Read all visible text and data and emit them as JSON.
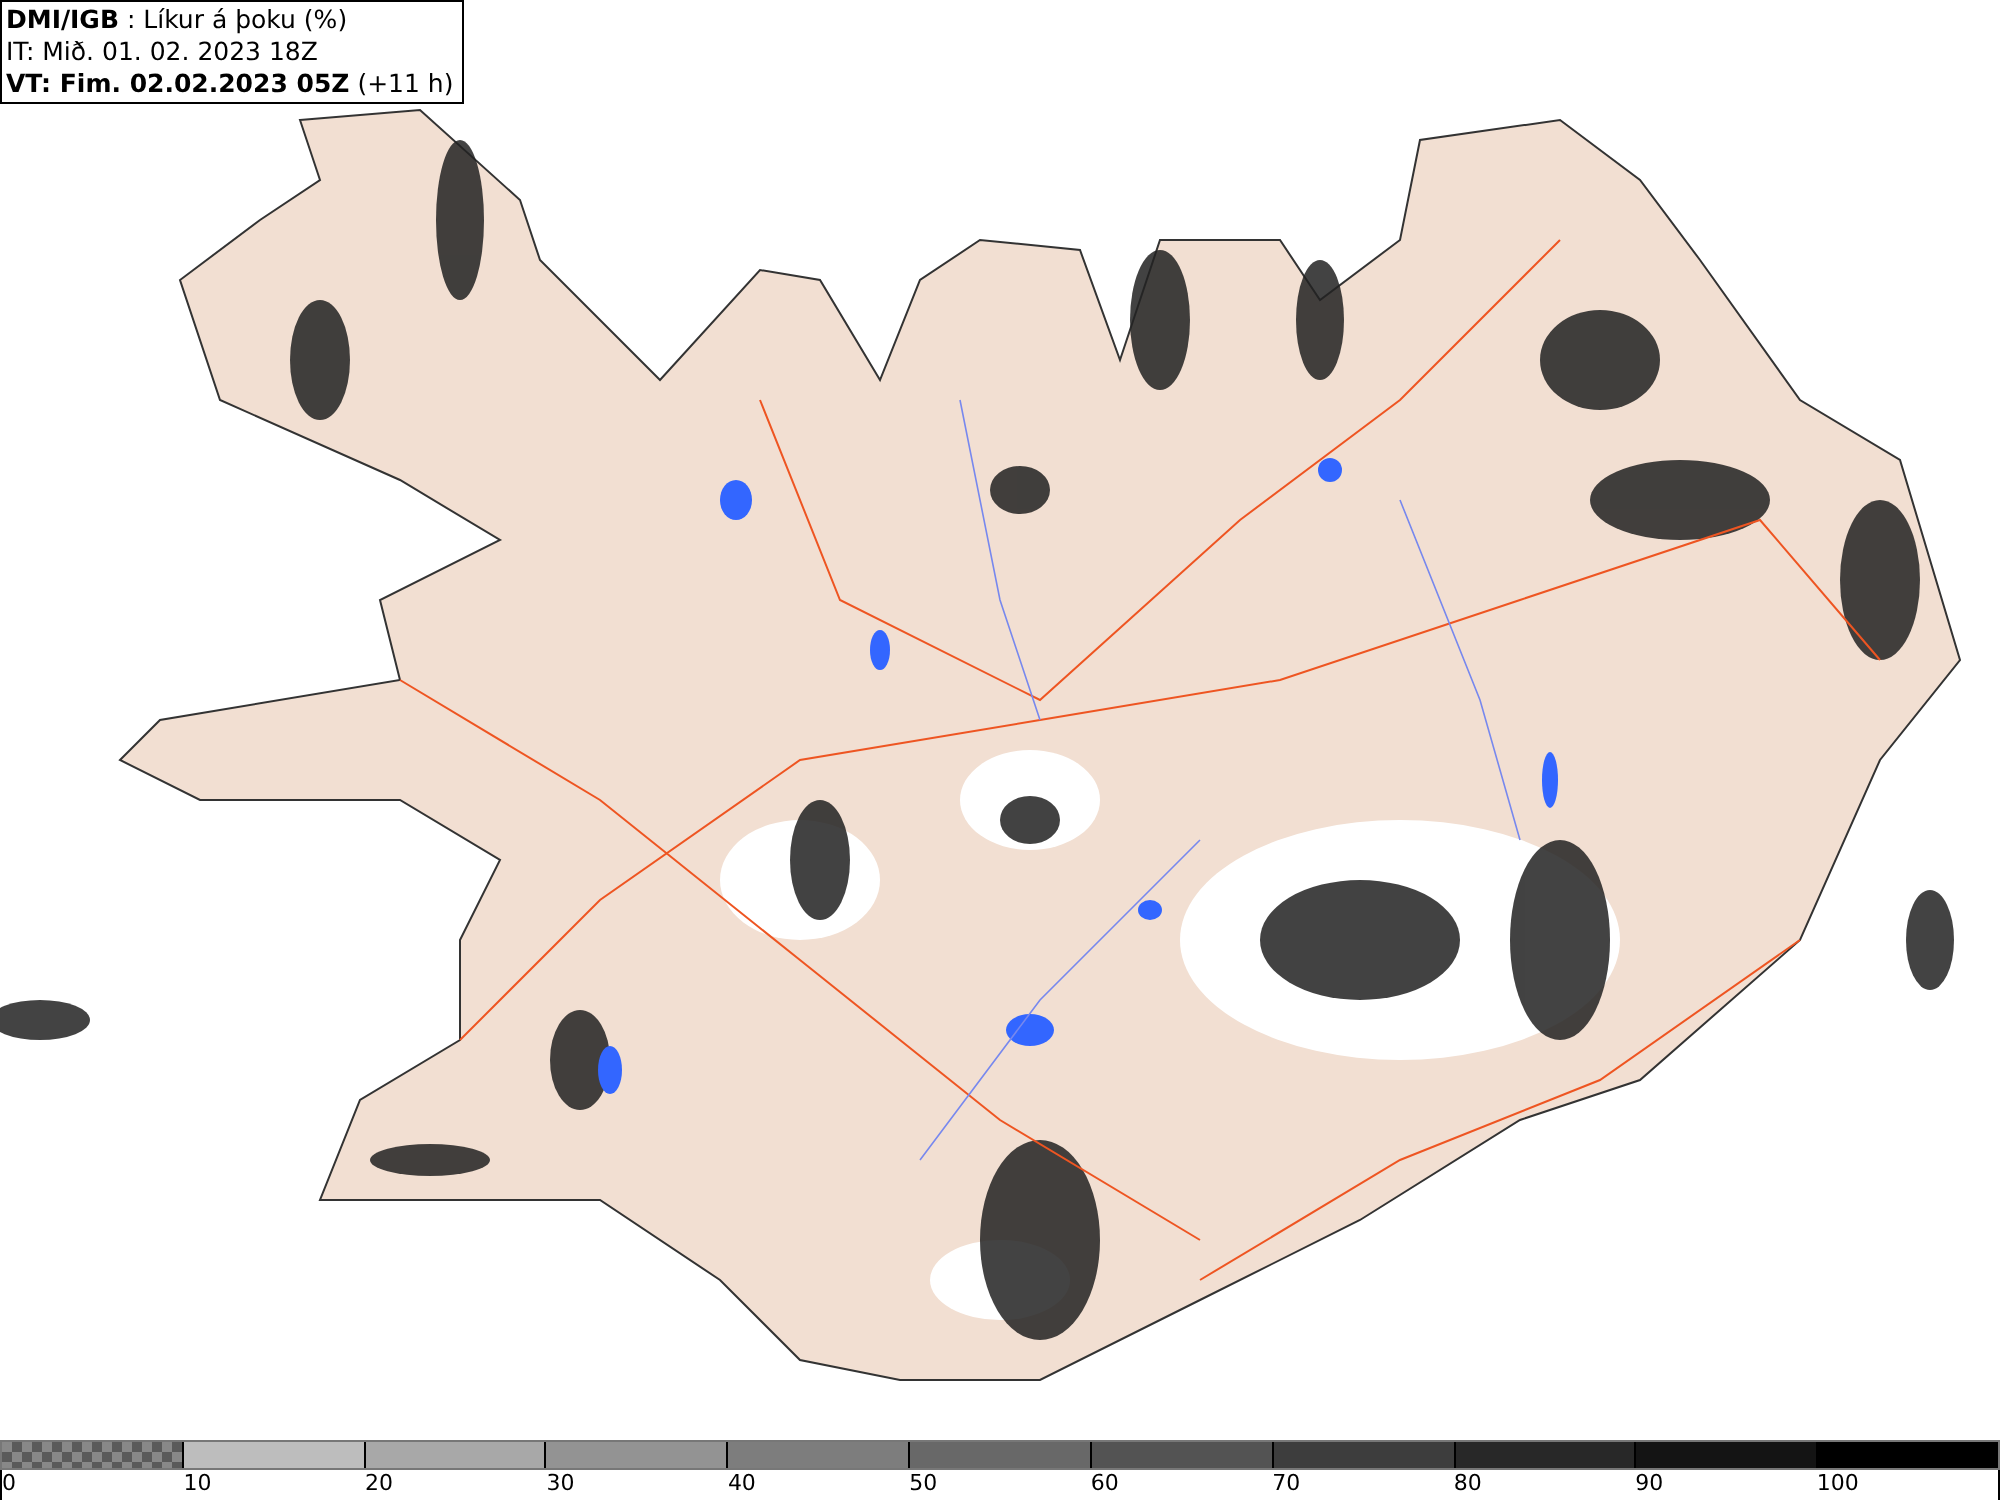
{
  "header": {
    "lines": [
      "**DMI/IGB** : Líkur á þoku (%)",
      "IT: Mið. 01. 02. 2023 18Z",
      "**VT: Fim. 02.02.2023 05Z** (+11 h)"
    ]
  },
  "legend": {
    "segments": [
      {
        "kind": "checker",
        "color": "#5a5a5a"
      },
      {
        "kind": "solid",
        "color": "#bdbdbd"
      },
      {
        "kind": "solid",
        "color": "#a8a8a8"
      },
      {
        "kind": "solid",
        "color": "#939393"
      },
      {
        "kind": "solid",
        "color": "#7d7d7d"
      },
      {
        "kind": "solid",
        "color": "#686868"
      },
      {
        "kind": "solid",
        "color": "#535353"
      },
      {
        "kind": "solid",
        "color": "#3d3d3d"
      },
      {
        "kind": "solid",
        "color": "#282828"
      },
      {
        "kind": "solid",
        "color": "#141414"
      },
      {
        "kind": "solid",
        "color": "#000000"
      }
    ],
    "ticks": [
      "0",
      "10",
      "20",
      "30",
      "40",
      "50",
      "60",
      "70",
      "80",
      "90",
      "100"
    ]
  }
}
